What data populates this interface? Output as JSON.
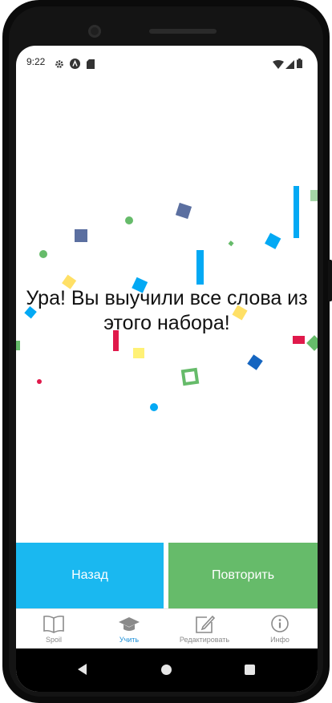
{
  "status_bar": {
    "time": "9:22",
    "icons_left": [
      "gear-icon",
      "a-badge-icon",
      "sd-card-icon"
    ],
    "icons_right": [
      "wifi-icon",
      "signal-icon",
      "battery-icon"
    ]
  },
  "main": {
    "message": "Ура! Вы выучили все слова из этого набора!"
  },
  "actions": {
    "back_label": "Назад",
    "repeat_label": "Повторить"
  },
  "tabs": [
    {
      "label": "Spoil",
      "icon": "book-icon",
      "active": false
    },
    {
      "label": "Учить",
      "icon": "graduation-cap-icon",
      "active": true
    },
    {
      "label": "Редактировать",
      "icon": "edit-icon",
      "active": false
    },
    {
      "label": "Инфо",
      "icon": "info-icon",
      "active": false
    }
  ],
  "colors": {
    "back_button": "#1ab8f0",
    "repeat_button": "#66bb6a",
    "active_tab": "#1a8fd8",
    "inactive_tab": "#8a8a8a",
    "confetti": [
      "#03a9f4",
      "#5b6fa0",
      "#66bb6a",
      "#ffe066",
      "#e0194b",
      "#1565c0"
    ]
  }
}
